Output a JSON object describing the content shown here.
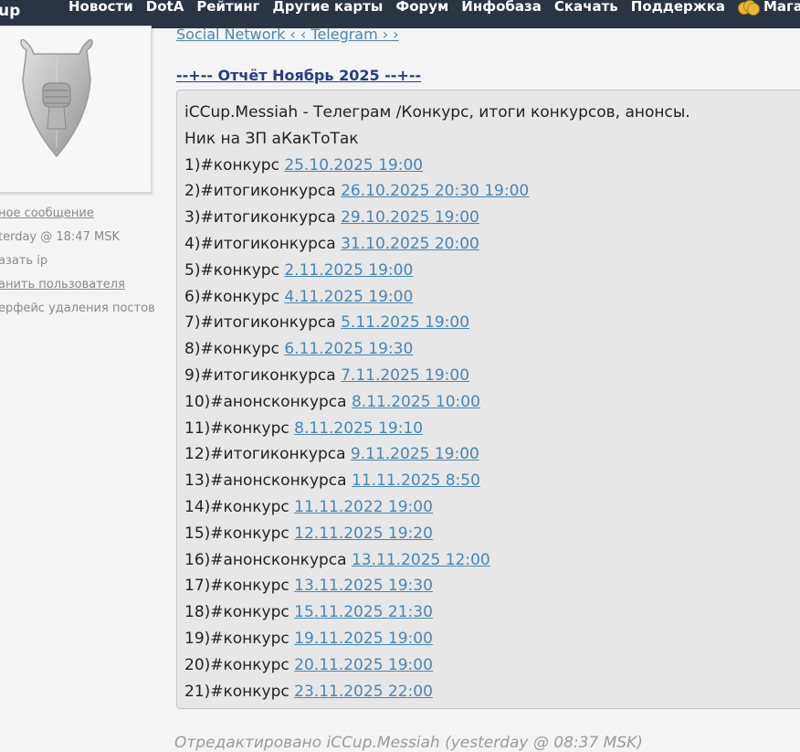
{
  "nav": {
    "logo": "up",
    "items": [
      "Новости",
      "DotA",
      "Рейтинг",
      "Другие карты",
      "Форум",
      "Инфобаза",
      "Скачать",
      "Поддержка"
    ],
    "shop_label": "Магазин"
  },
  "sidebar": {
    "links": [
      "ное сообщение",
      "terday @ 18:47 MSK",
      "азать ip",
      "анить пользователя",
      "ерфейс удаления постов"
    ]
  },
  "post": {
    "social_link": "Social Network ‹ ‹ Telegram › ›",
    "report_title": "--+-- Отчёт Ноябрь 2025 --+--",
    "header_lines": [
      "iCCup.Messiah - Телеграм /Конкурс, итоги конкурсов, анонсы.",
      "Ник на ЗП аКакТоТак"
    ],
    "entries": [
      {
        "prefix": "1)#конкурс ",
        "date": "25.10.2025 19:00"
      },
      {
        "prefix": "2)#итогиконкурса ",
        "date": "26.10.2025 20:30 19:00"
      },
      {
        "prefix": "3)#итогиконкурса ",
        "date": "29.10.2025 19:00"
      },
      {
        "prefix": "4)#итогиконкурса ",
        "date": "31.10.2025 20:00"
      },
      {
        "prefix": "5)#конкурс ",
        "date": "2.11.2025 19:00"
      },
      {
        "prefix": "6)#конкурс ",
        "date": "4.11.2025 19:00"
      },
      {
        "prefix": "7)#итогиконкурса ",
        "date": "5.11.2025 19:00"
      },
      {
        "prefix": "8)#конкурс ",
        "date": "6.11.2025 19:30"
      },
      {
        "prefix": "9)#итогиконкурса ",
        "date": "7.11.2025 19:00"
      },
      {
        "prefix": "10)#анонсконкурса ",
        "date": "8.11.2025 10:00"
      },
      {
        "prefix": "11)#конкурс ",
        "date": "8.11.2025 19:10"
      },
      {
        "prefix": "12)#итогиконкурса ",
        "date": "9.11.2025 19:00"
      },
      {
        "prefix": "13)#анонсконкурса ",
        "date": "11.11.2025 8:50"
      },
      {
        "prefix": "14)#конкурс ",
        "date": "11.11.2022 19:00"
      },
      {
        "prefix": "15)#конкурс ",
        "date": "12.11.2025 19:20"
      },
      {
        "prefix": "16)#анонсконкурса ",
        "date": "13.11.2025 12:00"
      },
      {
        "prefix": "17)#конкурс ",
        "date": "13.11.2025 19:30"
      },
      {
        "prefix": "18)#конкурс ",
        "date": "15.11.2025 21:30"
      },
      {
        "prefix": "19)#конкурс ",
        "date": "19.11.2025 19:00"
      },
      {
        "prefix": "20)#конкурс ",
        "date": "20.11.2025 19:00"
      },
      {
        "prefix": "21)#конкурс ",
        "date": "23.11.2025 22:00"
      }
    ],
    "edited_note": "Отредактировано iCCup.Messiah (yesterday @ 08:37 MSK)"
  }
}
